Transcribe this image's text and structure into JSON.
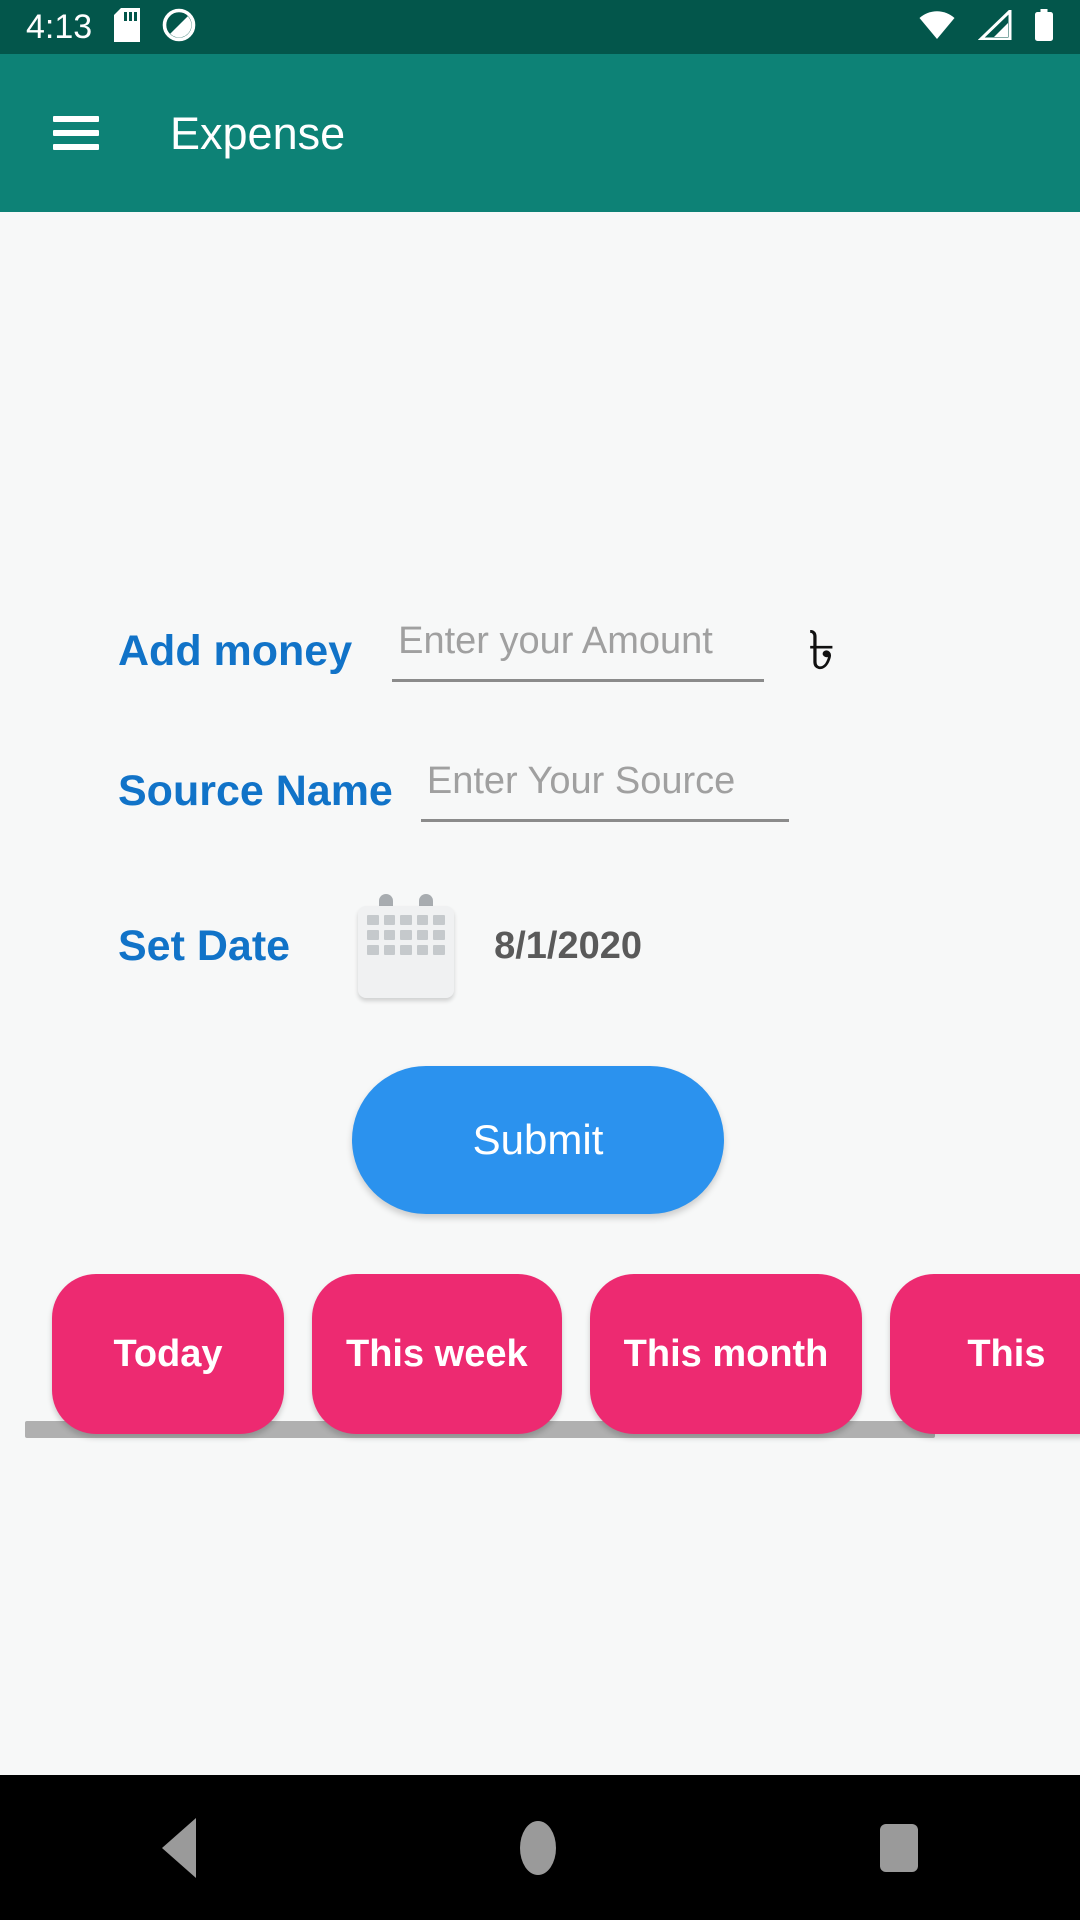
{
  "status_bar": {
    "time": "4:13",
    "icons": [
      "sd-card-icon",
      "do-not-disturb-icon",
      "wifi-icon",
      "cellular-signal-icon",
      "battery-icon"
    ],
    "background_color": "#03564B"
  },
  "app_bar": {
    "menu_icon": "hamburger-menu-icon",
    "title": "Expense",
    "background_color": "#0D8276",
    "title_color": "#FFFFFF"
  },
  "form": {
    "label_color": "#1173C8",
    "amount": {
      "label": "Add money",
      "placeholder": "Enter your Amount",
      "value": "",
      "currency_symbol": "৳"
    },
    "source": {
      "label": "Source Name",
      "placeholder": "Enter Your Source",
      "value": ""
    },
    "date": {
      "label": "Set Date",
      "icon": "calendar-icon",
      "value": "8/1/2020"
    },
    "submit": {
      "label": "Submit",
      "color": "#2B92EE"
    }
  },
  "filters": {
    "chip_color": "#ED2A71",
    "chips": [
      {
        "label": "Today"
      },
      {
        "label": "This week"
      },
      {
        "label": "This month"
      },
      {
        "label": "This"
      }
    ],
    "scrollbar": "horizontal-scrollbar"
  },
  "nav_bar": {
    "background_color": "#000000",
    "buttons": [
      "back-icon",
      "home-icon",
      "recents-icon"
    ]
  }
}
